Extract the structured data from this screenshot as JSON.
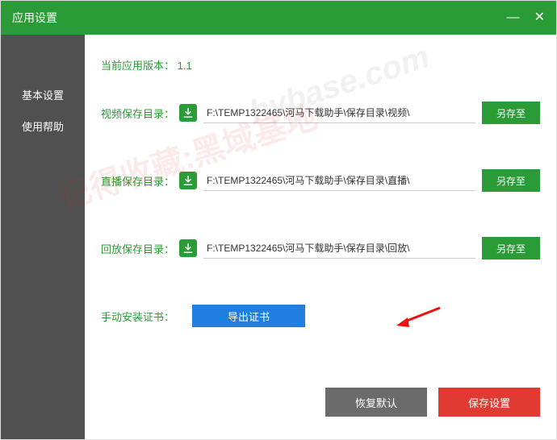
{
  "titlebar": {
    "title": "应用设置"
  },
  "sidebar": {
    "items": [
      {
        "label": "基本设置"
      },
      {
        "label": "使用帮助"
      }
    ]
  },
  "version": {
    "label": "当前应用版本：",
    "value": "1.1"
  },
  "rows": [
    {
      "label": "视频保存目录：",
      "path": "F:\\TEMP1322465\\河马下载助手\\保存目录\\视频\\",
      "button": "另存至"
    },
    {
      "label": "直播保存目录：",
      "path": "F:\\TEMP1322465\\河马下载助手\\保存目录\\直播\\",
      "button": "另存至"
    },
    {
      "label": "回放保存目录：",
      "path": "F:\\TEMP1322465\\河马下载助手\\保存目录\\回放\\",
      "button": "另存至"
    }
  ],
  "cert": {
    "label": "手动安装证书：",
    "button": "导出证书"
  },
  "footer": {
    "restore": "恢复默认",
    "save": "保存设置"
  },
  "watermark": {
    "text1": "记得收藏:黑域基地",
    "text2": "hybase.com"
  }
}
